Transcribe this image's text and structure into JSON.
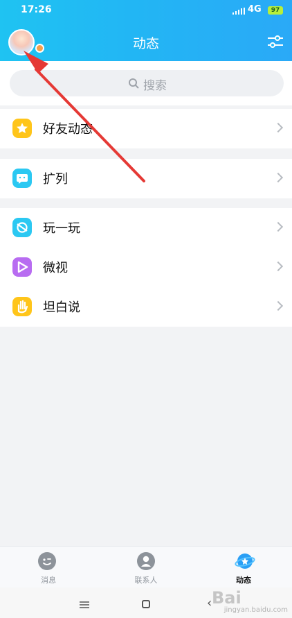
{
  "status_bar": {
    "time": "17:26",
    "network": "4G",
    "battery": "97"
  },
  "header": {
    "title": "动态"
  },
  "search": {
    "placeholder": "搜索"
  },
  "sections": [
    {
      "items": [
        {
          "label": "好友动态",
          "icon": "star-icon",
          "color": "#ffc51a"
        }
      ]
    },
    {
      "items": [
        {
          "label": "扩列",
          "icon": "smile-bubble-icon",
          "color": "#2bc8f2"
        }
      ]
    },
    {
      "items": [
        {
          "label": "玩一玩",
          "icon": "planet-icon",
          "color": "#2bc8f2"
        },
        {
          "label": "微视",
          "icon": "play-icon",
          "color": "#b86cf1"
        },
        {
          "label": "坦白说",
          "icon": "hand-icon",
          "color": "#ffc51a"
        }
      ]
    }
  ],
  "bottom_nav": [
    {
      "label": "消息",
      "icon": "message-icon",
      "active": false
    },
    {
      "label": "联系人",
      "icon": "contact-icon",
      "active": false
    },
    {
      "label": "动态",
      "icon": "planet-icon",
      "active": true
    }
  ],
  "watermark": {
    "text": "Bai",
    "sub": "jingyan.baidu.com"
  }
}
